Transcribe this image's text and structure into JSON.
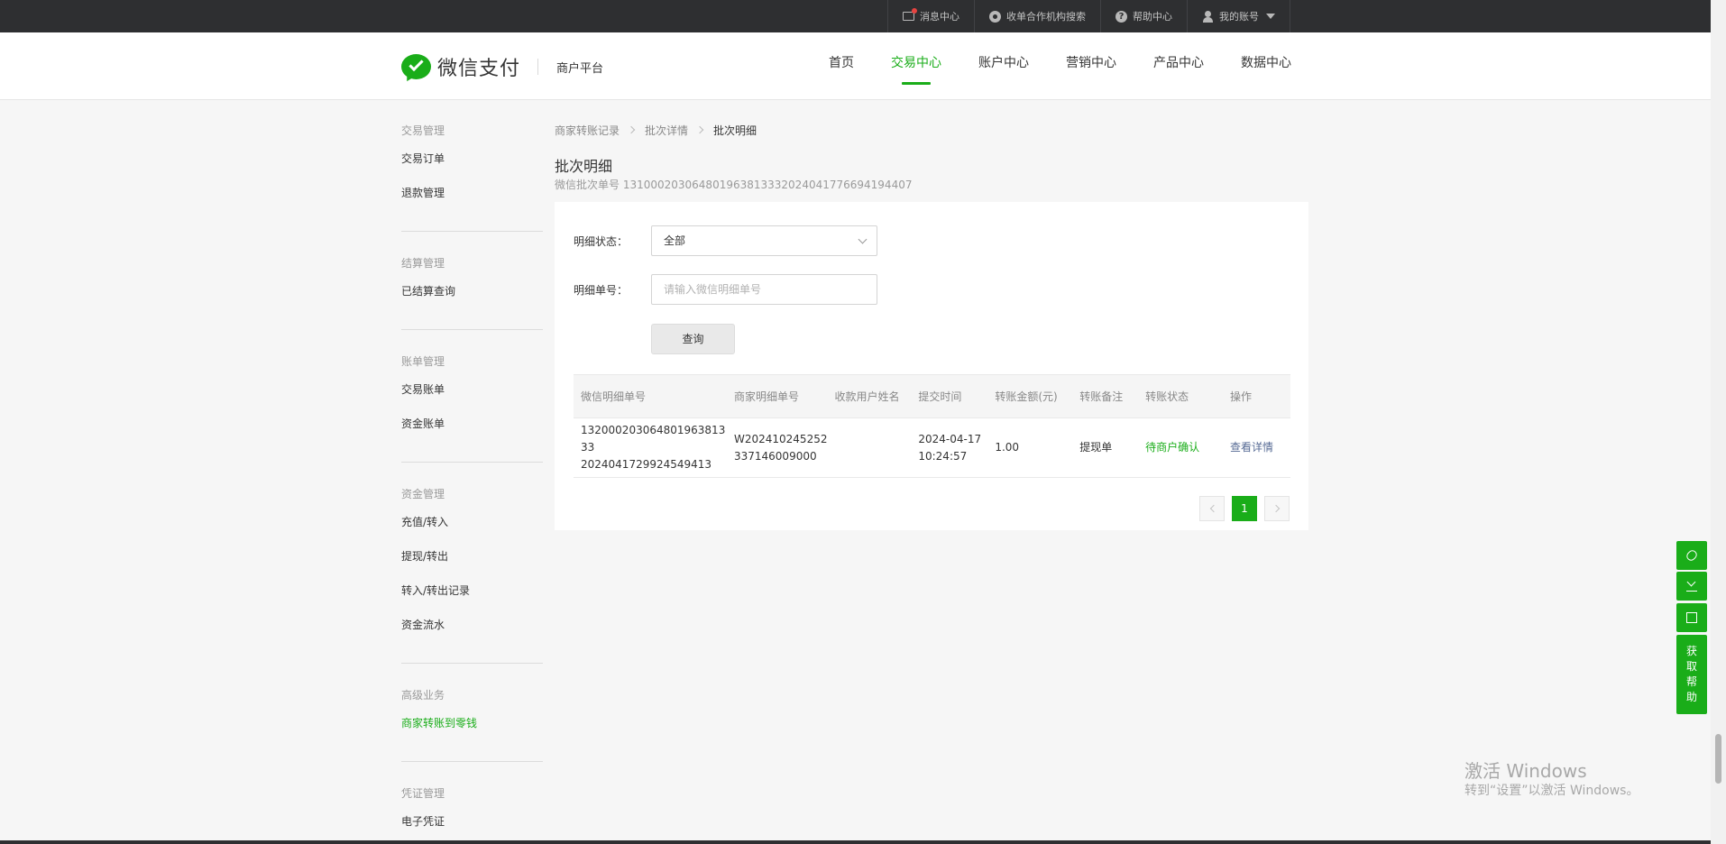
{
  "topbar": {
    "links": [
      {
        "label": "消息中心",
        "icon": "mail-icon"
      },
      {
        "label": "收单合作机构搜索",
        "icon": "search-org-icon"
      },
      {
        "label": "帮助中心",
        "icon": "help-icon"
      },
      {
        "label": "我的账号",
        "icon": "user-icon"
      }
    ],
    "help_glyph": "?"
  },
  "header": {
    "logo_text": "微信支付",
    "logo_sub": "商户平台",
    "nav": [
      {
        "label": "首页"
      },
      {
        "label": "交易中心"
      },
      {
        "label": "账户中心"
      },
      {
        "label": "营销中心"
      },
      {
        "label": "产品中心"
      },
      {
        "label": "数据中心"
      }
    ],
    "accent": "#1aad19"
  },
  "sidebar": {
    "groups": [
      {
        "title": "交易管理",
        "items": [
          "交易订单",
          "退款管理"
        ]
      },
      {
        "title": "结算管理",
        "items": [
          "已结算查询"
        ]
      },
      {
        "title": "账单管理",
        "items": [
          "交易账单",
          "资金账单"
        ]
      },
      {
        "title": "资金管理",
        "items": [
          "充值/转入",
          "提现/转出",
          "转入/转出记录",
          "资金流水"
        ]
      },
      {
        "title": "高级业务",
        "items": [
          "商家转账到零钱"
        ]
      },
      {
        "title": "凭证管理",
        "items": [
          "电子凭证"
        ]
      }
    ]
  },
  "breadcrumb": [
    "商家转账记录",
    "批次详情",
    "批次明细"
  ],
  "page": {
    "title": "批次明细",
    "subtitle": "微信批次单号 1310002030648019638133320240417766941944​07"
  },
  "form": {
    "status_label": "明细状态：",
    "status_value": "全部",
    "detail_no_label": "明细单号：",
    "detail_no_placeholder": "请输入微信明细单号",
    "query_button": "查询"
  },
  "table": {
    "headers": [
      "微信明细单号",
      "商家明细单号",
      "收款用户姓名",
      "提交时间",
      "转账金额(元)",
      "转账备注",
      "转账状态",
      "操作"
    ],
    "rows": [
      {
        "wx_no_1": "132000203064801963813​33",
        "wx_no_2": "2024041729924549413",
        "mch_no_1": "W202410245252",
        "mch_no_2": "337146009000",
        "user_name": "",
        "time_1": "2024-04-17",
        "time_2": "10:24:57",
        "amount": "1.00",
        "remark": "提现单",
        "status": "待商户确认",
        "action": "查看详情"
      }
    ]
  },
  "pager": {
    "current": "1"
  },
  "float_help": {
    "label": "获取帮助",
    "chars": [
      "获",
      "取",
      "帮",
      "助"
    ]
  },
  "watermark": {
    "line1": "激活 Windows",
    "line2": "转到“设置”以激活 Windows。"
  }
}
